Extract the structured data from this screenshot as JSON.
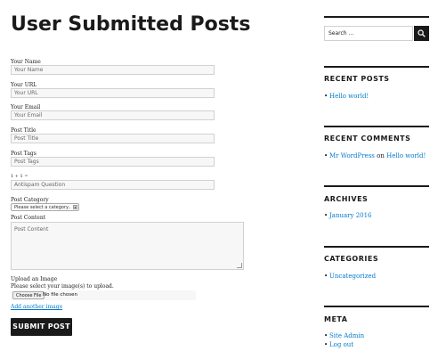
{
  "page": {
    "title": "User Submitted Posts"
  },
  "form": {
    "name_label": "Your Name",
    "name_placeholder": "Your Name",
    "url_label": "Your URL",
    "url_placeholder": "Your URL",
    "email_label": "Your Email",
    "email_placeholder": "Your Email",
    "post_title_label": "Post Title",
    "post_title_placeholder": "Post Title",
    "tags_label": "Post Tags",
    "tags_placeholder": "Post Tags",
    "antispam_label": "1 + 1 =",
    "antispam_placeholder": "Antispam Question",
    "category_label": "Post Category",
    "category_selected": "Please select a category..",
    "content_label": "Post Content",
    "content_placeholder": "Post Content",
    "upload_label": "Upload an Image",
    "upload_help": "Please select your image(s) to upload.",
    "choose_file_label": "Choose File",
    "file_status": "No file chosen",
    "add_image_link": "Add another image",
    "submit_label": "SUBMIT POST"
  },
  "sidebar": {
    "search_placeholder": "Search ...",
    "recent_posts_title": "RECENT POSTS",
    "recent_posts": [
      "Hello world!"
    ],
    "recent_comments_title": "RECENT COMMENTS",
    "recent_comment": {
      "author": "Mr WordPress",
      "on": "on",
      "post": "Hello world!"
    },
    "archives_title": "ARCHIVES",
    "archives": [
      "January 2016"
    ],
    "categories_title": "CATEGORIES",
    "categories": [
      "Uncategorized"
    ],
    "meta_title": "META",
    "meta_links": [
      "Site Admin",
      "Log out"
    ]
  },
  "colors": {
    "link": "#007acc",
    "text": "#1a1a1a",
    "button_bg": "#1a1a1a"
  }
}
